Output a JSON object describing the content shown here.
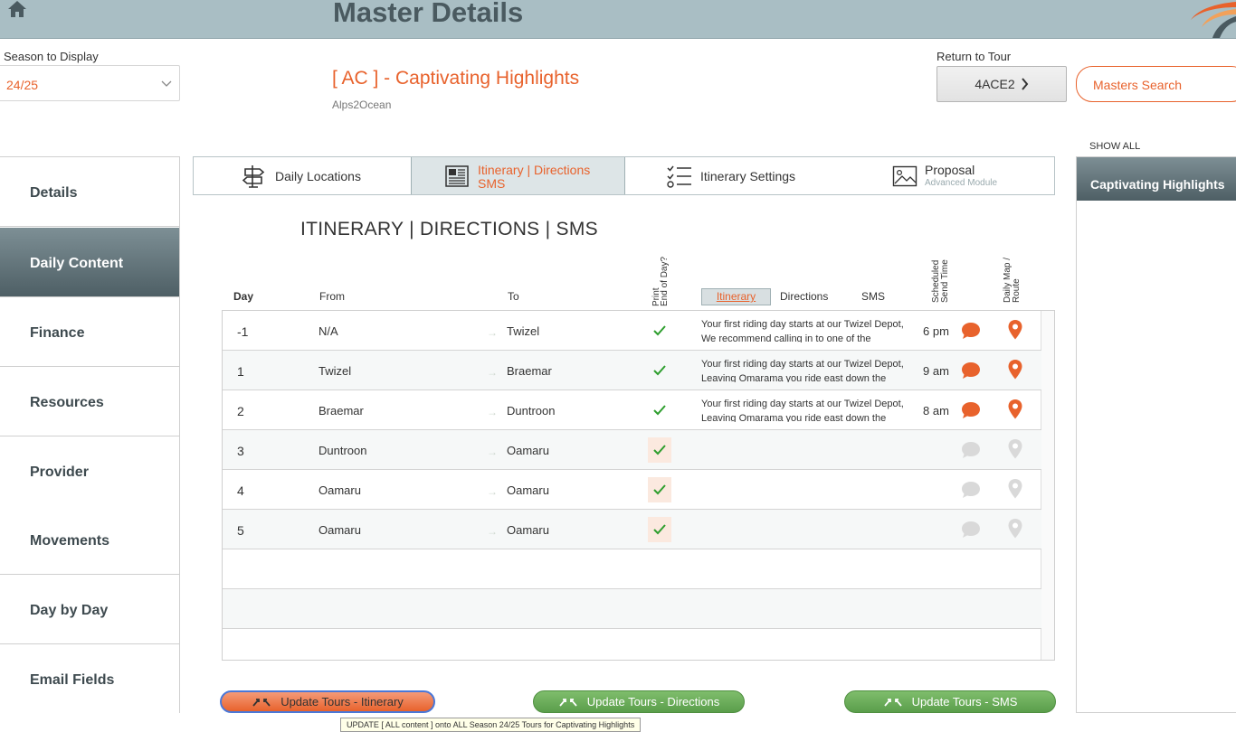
{
  "header": {
    "title": "Master Details"
  },
  "season": {
    "label": "Season to Display",
    "value": "24/25"
  },
  "tour": {
    "title": "[ AC ] - Captivating Highlights",
    "subtitle": "Alps2Ocean"
  },
  "return": {
    "label": "Return to Tour",
    "button": "4ACE2"
  },
  "search": {
    "label": "Masters Search"
  },
  "sidebar": {
    "items": [
      {
        "label": "Details"
      },
      {
        "label": "Daily Content"
      },
      {
        "label": "Finance"
      },
      {
        "label": "Resources"
      },
      {
        "label": "Provider"
      },
      {
        "label": "Movements"
      },
      {
        "label": "Day by Day"
      },
      {
        "label": "Email Fields"
      }
    ]
  },
  "tabs": [
    {
      "label": "Daily Locations"
    },
    {
      "label": "Itinerary | Directions",
      "label2": "SMS"
    },
    {
      "label": "Itinerary Settings"
    },
    {
      "label": "Proposal",
      "sub": "Advanced Module"
    }
  ],
  "section": {
    "heading": "ITINERARY | DIRECTIONS | SMS"
  },
  "table": {
    "headers": {
      "day": "Day",
      "from": "From",
      "to": "To",
      "print": "Print",
      "eod": "End of Day?",
      "itinerary": "Itinerary",
      "directions": "Directions",
      "sms": "SMS",
      "scheduled": "Scheduled",
      "sendtime": "Send Time",
      "dailymap": "Daily Map /",
      "route": "Route"
    },
    "rows": [
      {
        "day": "-1",
        "from": "N/A",
        "to": "Twizel",
        "text1": "Your first riding day starts at our Twizel Depot,",
        "text2": "We recommend calling in to one of the",
        "time": "6 pm"
      },
      {
        "day": "1",
        "from": "Twizel",
        "to": "Braemar",
        "text1": "Your first riding day starts at our Twizel Depot,",
        "text2": "Leaving Omarama you ride east down the",
        "time": "9 am"
      },
      {
        "day": "2",
        "from": "Braemar",
        "to": "Duntroon",
        "text1": "Your first riding day starts at our Twizel Depot,",
        "text2": "Leaving Omarama you ride east down the",
        "time": "8 am"
      },
      {
        "day": "3",
        "from": "Duntroon",
        "to": "Oamaru",
        "text1": "",
        "text2": "",
        "time": ""
      },
      {
        "day": "4",
        "from": "Oamaru",
        "to": "Oamaru",
        "text1": "",
        "text2": "",
        "time": ""
      },
      {
        "day": "5",
        "from": "Oamaru",
        "to": "Oamaru",
        "text1": "",
        "text2": "",
        "time": ""
      }
    ]
  },
  "buttons": {
    "itinerary": "Update Tours - Itinerary",
    "directions": "Update Tours - Directions",
    "sms": "Update Tours - SMS"
  },
  "tooltip": "UPDATE [ ALL content ] onto ALL Season 24/25 Tours for Captivating Highlights",
  "right_panel": {
    "show_all": "SHOW ALL",
    "item": "Captivating Highlights"
  },
  "colors": {
    "accent": "#e8622c",
    "header_bg": "#a9bec4",
    "check": "#2e9e2e",
    "green_button": "#5a9e4b"
  }
}
